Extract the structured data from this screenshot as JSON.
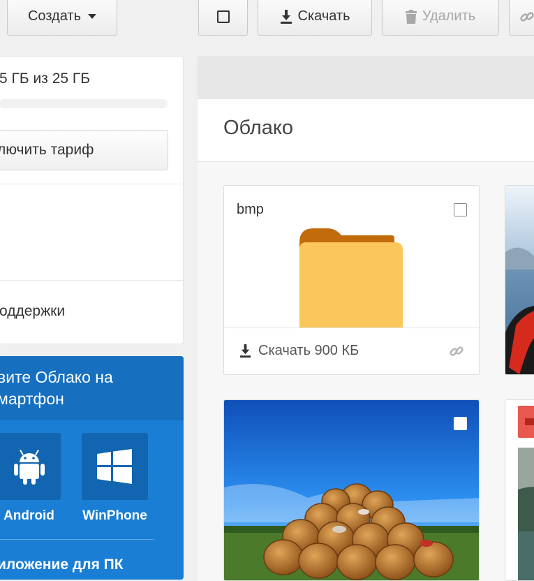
{
  "toolbar": {
    "create_label": "Создать",
    "download_label": "Скачать",
    "delete_label": "Удалить"
  },
  "sidebar": {
    "storage_text": "5 ГБ из 25 ГБ",
    "tariff_button": "лючить тариф",
    "support_text": "оддержки",
    "promo": {
      "title_line1": "вите Облако на",
      "title_line2": "мартфон",
      "android_label": "Android",
      "winphone_label": "WinPhone",
      "pc_app_text": "иложение для ПК"
    }
  },
  "main": {
    "title": "Облако",
    "folder": {
      "name": "bmp",
      "download_text": "Скачать 900 КБ"
    }
  },
  "colors": {
    "promo_bg": "#1a7fd4",
    "promo_header": "#1670bf",
    "folder_front": "#fcc75a",
    "folder_back": "#c26b0b"
  }
}
